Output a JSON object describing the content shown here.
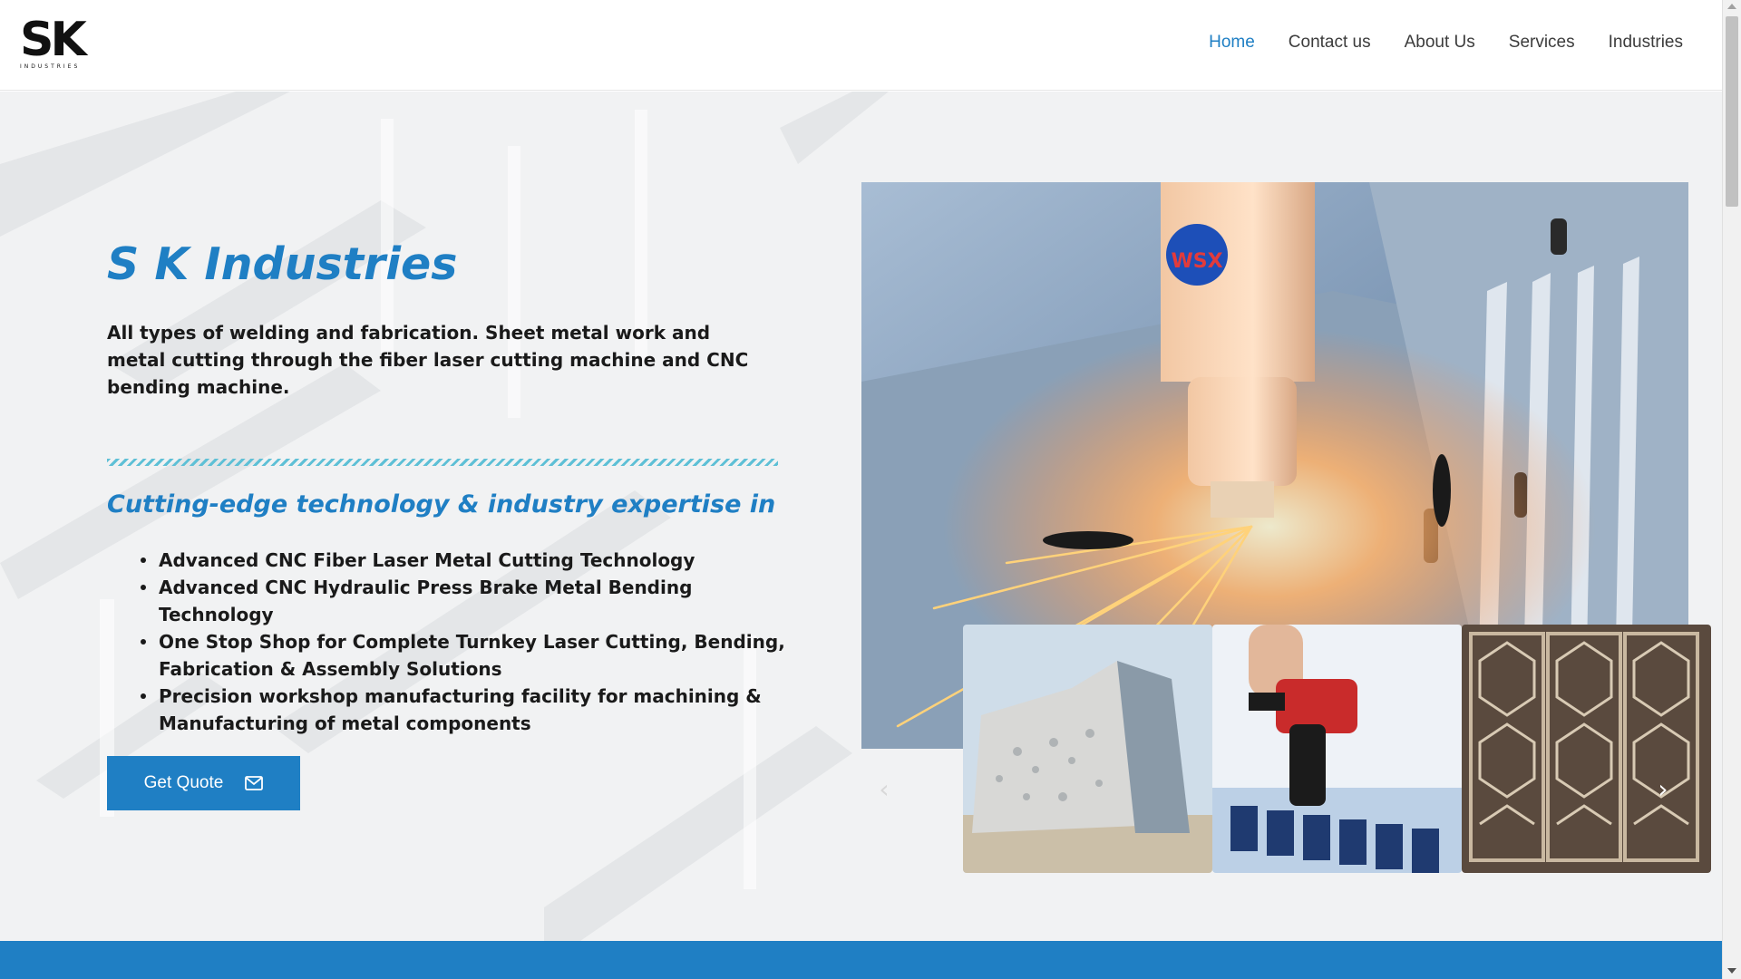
{
  "header": {
    "logo_mark": "SK",
    "logo_sub": "INDUSTRIES",
    "nav": [
      {
        "label": "Home",
        "active": true
      },
      {
        "label": "Contact us",
        "active": false
      },
      {
        "label": "About Us",
        "active": false
      },
      {
        "label": "Services",
        "active": false
      },
      {
        "label": "Industries",
        "active": false
      }
    ]
  },
  "hero": {
    "title": "S K Industries",
    "description": "All types of welding and fabrication. Sheet metal work and metal cutting through the fiber laser cutting machine and CNC bending machine.",
    "subtitle": "Cutting-edge technology & industry expertise in",
    "features": [
      "Advanced CNC Fiber Laser Metal Cutting Technology",
      "Advanced CNC Hydraulic Press Brake Metal Bending Technology",
      "One Stop Shop for Complete Turnkey Laser Cutting, Bending, Fabrication & Assembly Solutions",
      "Precision workshop manufacturing facility for machining & Manufacturing of metal components"
    ],
    "cta_label": "Get Quote",
    "cta_icon": "envelope-icon",
    "main_image_badge": "WSX"
  },
  "gallery": {
    "thumbs": [
      "perforated-facade-building",
      "cordless-drill-assembly",
      "laser-cut-screen-panel"
    ],
    "prev_glyph": "‹",
    "next_glyph": "›"
  },
  "colors": {
    "accent": "#1f7fc4",
    "divider": "#5ec0d6",
    "text": "#1a1a1a"
  }
}
